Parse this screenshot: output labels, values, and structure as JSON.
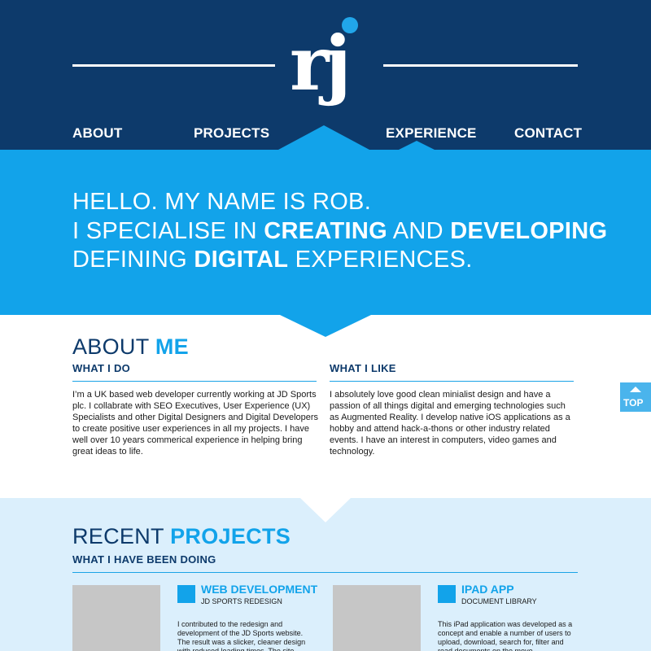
{
  "colors": {
    "navy": "#0d3a6b",
    "accent": "#12a3ea",
    "light": "#dbeffc"
  },
  "logo": {
    "text": "rj"
  },
  "nav": {
    "about": "ABOUT",
    "projects": "PROJECTS",
    "experience": "EXPERIENCE",
    "contact": "CONTACT"
  },
  "hero": {
    "line1": "HELLO. MY NAME IS ROB.",
    "line2_a": "I SPECIALISE IN ",
    "line2_b": "CREATING",
    "line2_c": " AND ",
    "line2_d": "DEVELOPING",
    "line3_a": "DEFINING ",
    "line3_b": "DIGITAL",
    "line3_c": " EXPERIENCES."
  },
  "about": {
    "title_a": "ABOUT ",
    "title_b": "ME",
    "what_i_do_heading": "WHAT I DO",
    "what_i_do_text": "I’m a UK based web developer currently working at JD Sports plc. I collabrate with SEO Executives, User Experience (UX) Specialists and other Digital Designers and Digital Developers to create positive user experiences in all my projects. I have well over 10 years commerical experience in helping bring great ideas to life.",
    "what_i_like_heading": "WHAT I LIKE",
    "what_i_like_text": "I absolutely love good clean minialist design and have a passion of all things digital and emerging technologies such as Augmented Reality. I develop native iOS applications as a hobby and attend hack-a-thons or other industry related events. I have an interest in computers, video games and technology."
  },
  "top_button": {
    "label": "TOP",
    "icon": "arrow-up-icon"
  },
  "projects": {
    "title_a": "RECENT ",
    "title_b": "PROJECTS",
    "subheading": "WHAT I HAVE BEEN DOING",
    "items": [
      {
        "title": "WEB DEVELOPMENT",
        "subtitle": "JD SPORTS REDESIGN",
        "description": "I contributed to the redesign and development of the JD Sports website. The result was a slicker, cleaner design with reduced loading times. The site"
      },
      {
        "title": "IPAD APP",
        "subtitle": "DOCUMENT LIBRARY",
        "description": "This iPad application was developed as a concept and enable a number of users to upload, download, search for, filter and read documents on the move."
      }
    ]
  }
}
